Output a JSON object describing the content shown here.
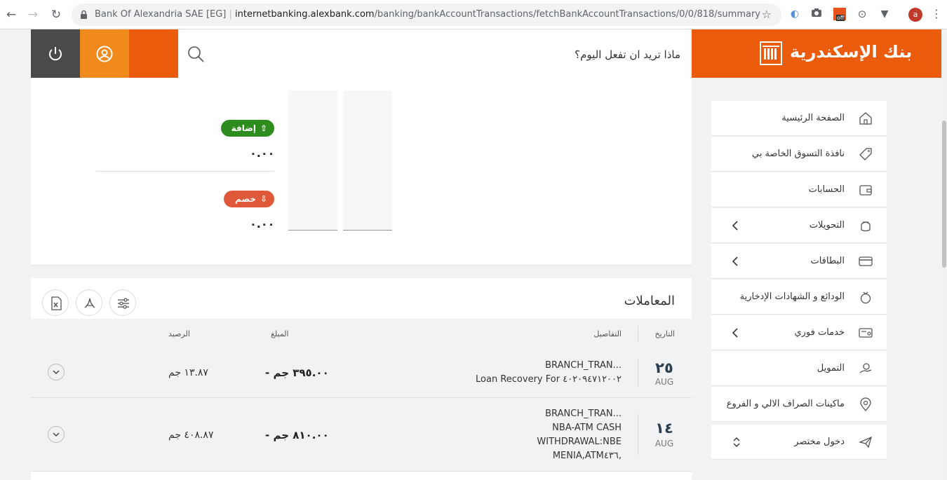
{
  "browser": {
    "site_label": "Bank Of Alexandria SAE [EG]",
    "url_host": "internetbanking.alexbank.com",
    "url_path": "/banking/bankAccountTransactions/fetchBankAccountTransactions/0/0/818/summary",
    "ext_badge": "off",
    "profile_initial": "a"
  },
  "header": {
    "logo_text": "بنك الإسكندرية",
    "search_placeholder": "ماذا تريد ان تفعل اليوم؟"
  },
  "summary": {
    "credit_label": "إضافة",
    "credit_amount": "٠.٠٠",
    "debit_label": "خصم",
    "debit_amount": "٠.٠٠"
  },
  "transactions": {
    "title": "المعاملات",
    "headers": {
      "date": "التاريخ",
      "details": "التفاصيل",
      "amount": "المبلغ",
      "balance": "الرصيد"
    },
    "rows": [
      {
        "day": "٢٥",
        "month": "AUG",
        "detail_1": "BRANCH_TRAN...",
        "detail_2": "Loan Recovery For ٤٠٢٠٩٤٧١٢٠٠٢",
        "amount": "- ٣٩٥.٠٠ جم",
        "balance": "١٣.٨٧ جم"
      },
      {
        "day": "١٤",
        "month": "AUG",
        "detail_1": "BRANCH_TRAN...",
        "detail_2": "NBA-ATM CASH",
        "detail_3": "WITHDRAWAL:NBE",
        "detail_4": "MENIA,ATM٤٣٦,",
        "amount": "- ٨١٠.٠٠ جم",
        "balance": "٤٠٨.٨٧ جم"
      }
    ]
  },
  "sidebar": {
    "items": [
      {
        "label": "الصفحة الرئيسية",
        "icon": "home-icon"
      },
      {
        "label": "نافذة التسوق الخاصة بي",
        "icon": "tag-icon"
      },
      {
        "label": "الحسابات",
        "icon": "wallet-icon"
      },
      {
        "label": "التحويلات",
        "icon": "transfer-icon"
      },
      {
        "label": "البطاقات",
        "icon": "card-icon"
      },
      {
        "label": "الودائع و الشهادات الإدخارية",
        "icon": "deposit-icon"
      },
      {
        "label": "خدمات فوري",
        "icon": "fawry-icon"
      },
      {
        "label": "التمويل",
        "icon": "finance-icon"
      },
      {
        "label": "ماكينات الصراف الالي و الفروع",
        "icon": "location-icon"
      },
      {
        "label": "دخول مختصر",
        "icon": "quick-login-icon"
      }
    ]
  },
  "colors": {
    "brand_orange": "#ea5b0c",
    "accent_orange": "#f18a1c",
    "credit_green": "#2e8b1e",
    "debit_red": "#e0583a",
    "dark": "#4a4a4a"
  }
}
